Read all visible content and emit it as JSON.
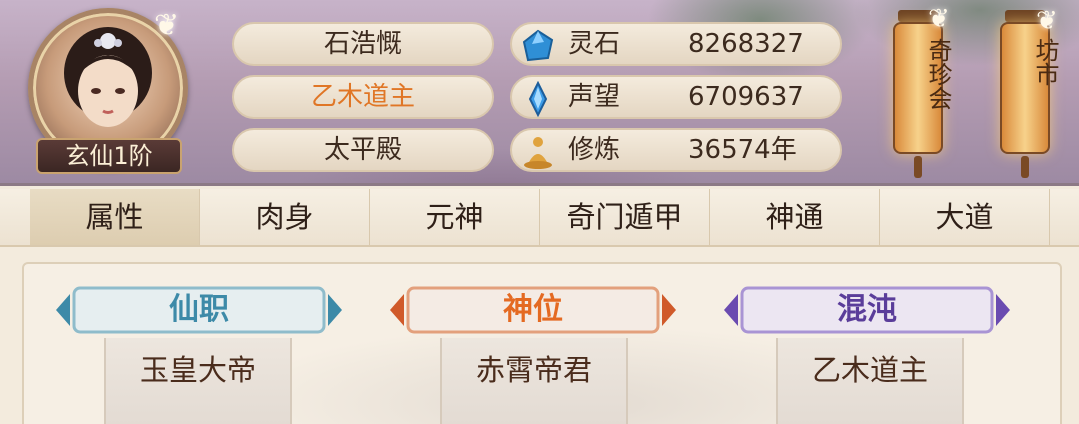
{
  "player": {
    "rank_badge": "玄仙1阶",
    "name": "石浩慨",
    "title": "乙木道主",
    "palace": "太平殿"
  },
  "resources": [
    {
      "icon": "spirit-stone-icon",
      "label": "灵石",
      "value": "8268327"
    },
    {
      "icon": "reputation-crystal-icon",
      "label": "声望",
      "value": "6709637"
    },
    {
      "icon": "meditation-icon",
      "label": "修炼",
      "value": "36574年"
    }
  ],
  "lanterns": [
    {
      "label": "奇珍会"
    },
    {
      "label": "坊市"
    }
  ],
  "tabs": [
    {
      "label": "属性",
      "active": true
    },
    {
      "label": "肉身",
      "active": false
    },
    {
      "label": "元神",
      "active": false
    },
    {
      "label": "奇门遁甲",
      "active": false
    },
    {
      "label": "神通",
      "active": false
    },
    {
      "label": "大道",
      "active": false
    }
  ],
  "attributes": [
    {
      "label": "仙职",
      "value": "玉皇大帝",
      "color": "#3d8aa8"
    },
    {
      "label": "神位",
      "value": "赤霄帝君",
      "color": "#e46a22"
    },
    {
      "label": "混沌",
      "value": "乙木道主",
      "color": "#5a3d9a"
    }
  ],
  "colors": {
    "highlight_title": "#e07626",
    "text_dark": "#3c2a1e"
  }
}
